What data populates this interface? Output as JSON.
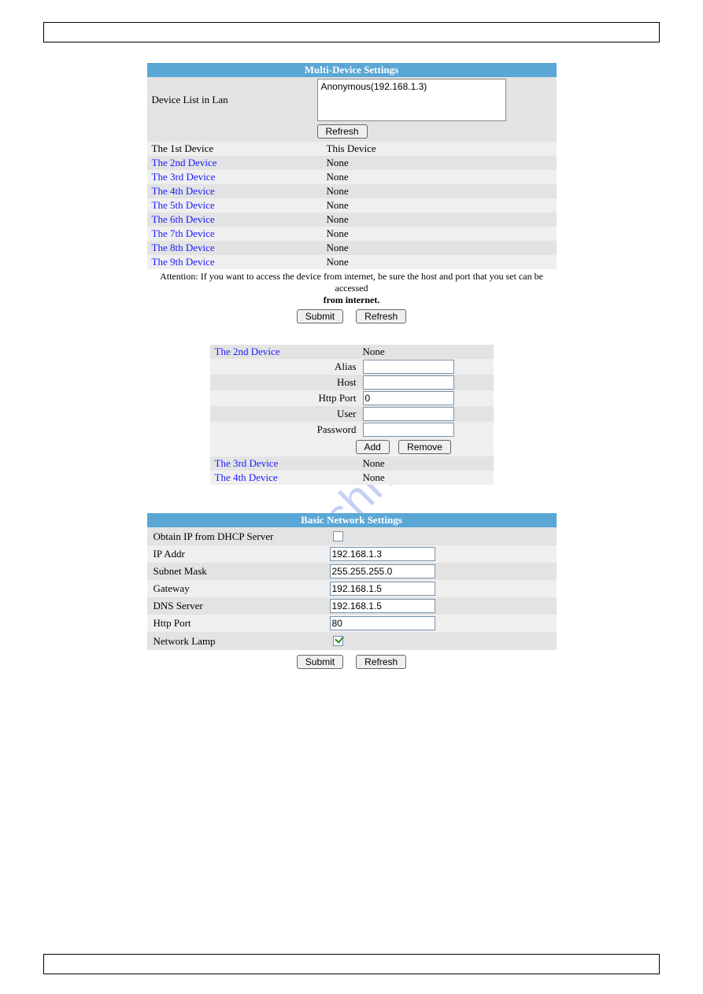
{
  "watermark": "manualshive.com",
  "multi": {
    "title": "Multi-Device Settings",
    "device_list_label": "Device List in Lan",
    "device_list_entry": "Anonymous(192.168.1.3)",
    "refresh_label": "Refresh",
    "rows": [
      {
        "label": "The 1st Device",
        "value": "This Device",
        "link": false
      },
      {
        "label": "The 2nd Device",
        "value": "None",
        "link": true
      },
      {
        "label": "The 3rd Device",
        "value": "None",
        "link": true
      },
      {
        "label": "The 4th Device",
        "value": "None",
        "link": true
      },
      {
        "label": "The 5th Device",
        "value": "None",
        "link": true
      },
      {
        "label": "The 6th Device",
        "value": "None",
        "link": true
      },
      {
        "label": "The 7th Device",
        "value": "None",
        "link": true
      },
      {
        "label": "The 8th Device",
        "value": "None",
        "link": true
      },
      {
        "label": "The 9th Device",
        "value": "None",
        "link": true
      }
    ],
    "attention_line1": "Attention: If you want to access the device from internet, be sure the host and port that you set can be accessed",
    "attention_line2": "from internet.",
    "submit_label": "Submit",
    "refresh_label2": "Refresh"
  },
  "expand": {
    "header_label": "The 2nd Device",
    "header_value": "None",
    "alias_label": "Alias",
    "alias_value": "",
    "host_label": "Host",
    "host_value": "",
    "http_port_label": "Http Port",
    "http_port_value": "0",
    "user_label": "User",
    "user_value": "",
    "password_label": "Password",
    "password_value": "",
    "add_label": "Add",
    "remove_label": "Remove",
    "tail": [
      {
        "label": "The 3rd Device",
        "value": "None"
      },
      {
        "label": "The 4th Device",
        "value": "None"
      }
    ]
  },
  "net": {
    "title": "Basic Network Settings",
    "dhcp_label": "Obtain IP from DHCP Server",
    "dhcp_checked": false,
    "ip_label": "IP Addr",
    "ip_value": "192.168.1.3",
    "mask_label": "Subnet Mask",
    "mask_value": "255.255.255.0",
    "gw_label": "Gateway",
    "gw_value": "192.168.1.5",
    "dns_label": "DNS Server",
    "dns_value": "192.168.1.5",
    "port_label": "Http Port",
    "port_value": "80",
    "lamp_label": "Network Lamp",
    "lamp_checked": true,
    "submit_label": "Submit",
    "refresh_label": "Refresh"
  }
}
